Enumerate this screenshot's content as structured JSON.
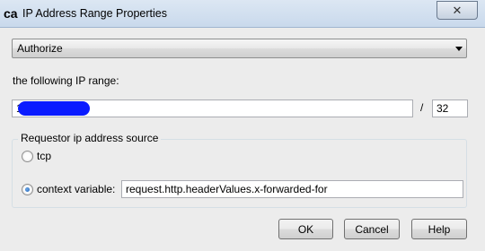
{
  "window": {
    "logo_text": "ca",
    "title": "IP Address Range Properties",
    "close_glyph": "✕"
  },
  "action_combo": {
    "selected": "Authorize"
  },
  "range_label": "the following IP range:",
  "ip_field": {
    "value": "1"
  },
  "slash": "/",
  "mask_field": {
    "value": "32"
  },
  "source_group": {
    "legend": "Requestor ip address source",
    "tcp_label": "tcp",
    "tcp_selected": false,
    "context_label": "context variable:",
    "context_selected": true,
    "context_value": "request.http.headerValues.x-forwarded-for"
  },
  "buttons": {
    "ok": "OK",
    "cancel": "Cancel",
    "help": "Help"
  },
  "icons": [
    "ca-logo-icon",
    "close-icon",
    "dropdown-arrow-icon"
  ]
}
